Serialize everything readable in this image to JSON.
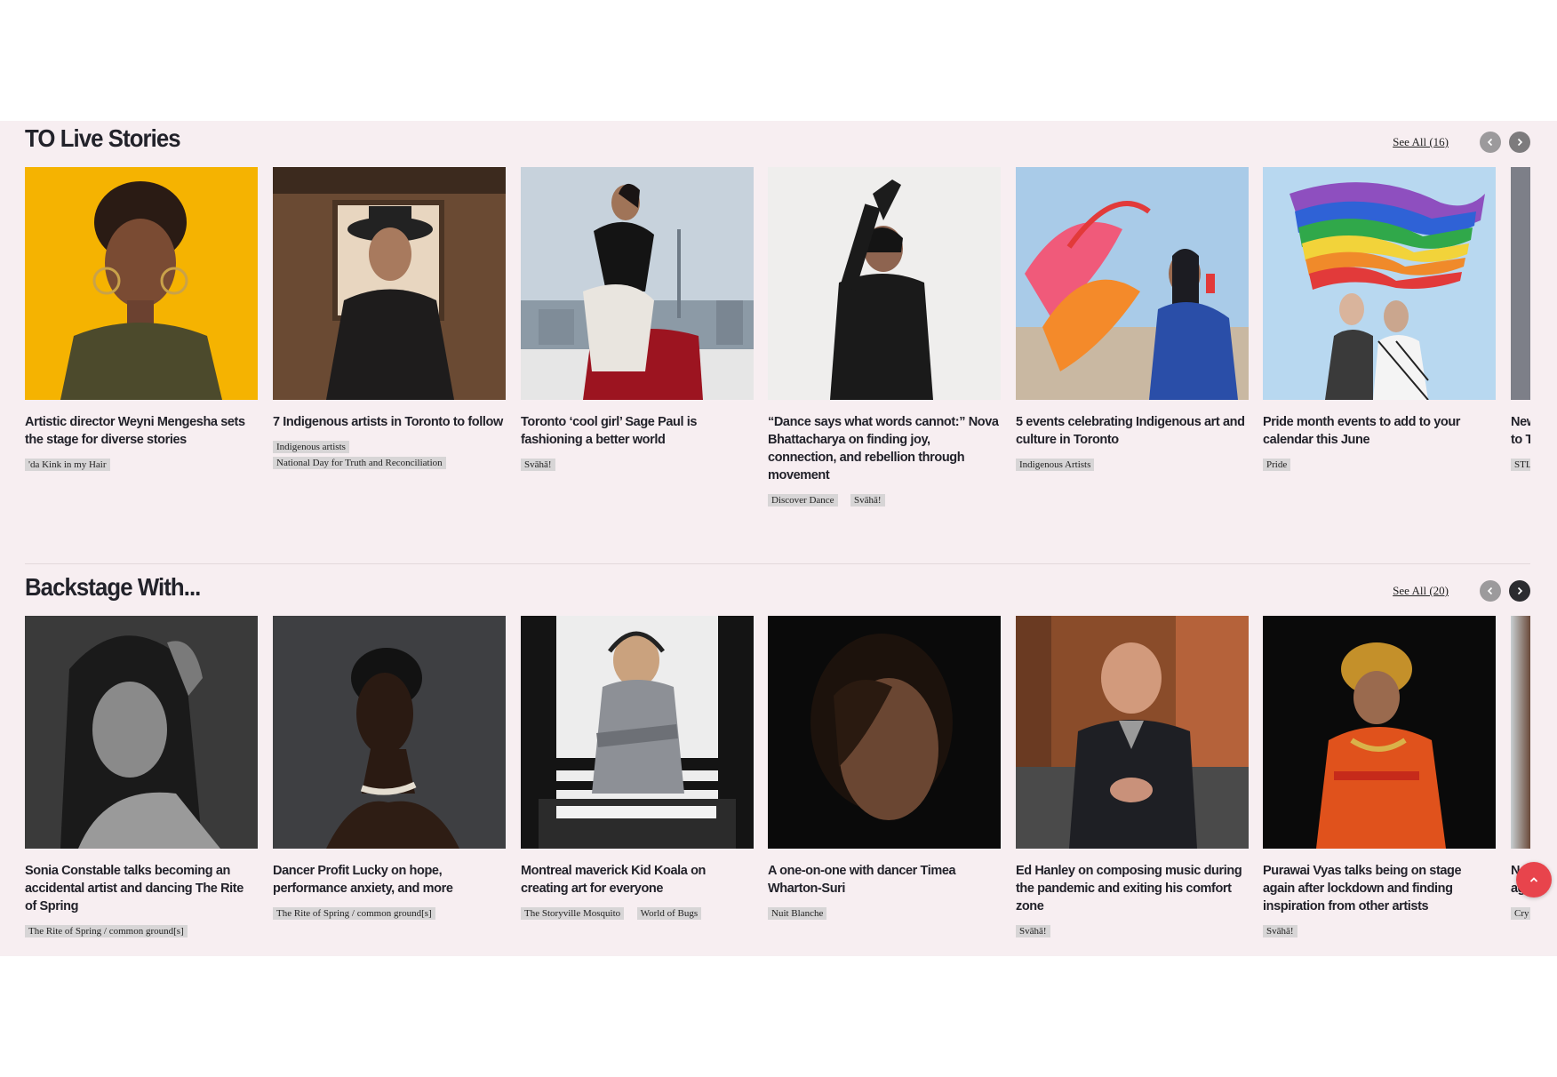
{
  "stories": {
    "title": "TO Live Stories",
    "see_all": "See All (16)",
    "cards": [
      {
        "title": "Artistic director Weyni Mengesha sets the stage for diverse stories",
        "tags": [
          "'da Kink in my Hair"
        ]
      },
      {
        "title": "7 Indigenous artists in Toronto to follow",
        "tags": [
          "Indigenous artists",
          "National Day for Truth and Reconciliation"
        ]
      },
      {
        "title": "Toronto ‘cool girl’ Sage Paul is fashioning a better world",
        "tags": [
          "Svāhā!"
        ]
      },
      {
        "title": "“Dance says what words cannot:” Nova Bhattacharya on finding joy, connection, and rebellion through movement",
        "tags": [
          "Discover Dance",
          "Svāhā!"
        ]
      },
      {
        "title": "5 events celebrating Indigenous art and culture in Toronto",
        "tags": [
          "Indigenous Artists"
        ]
      },
      {
        "title": "Pride month events to add to your calendar this June",
        "tags": [
          "Pride"
        ]
      }
    ],
    "partial": {
      "line1": "New",
      "line2": "to T",
      "tag": "STL"
    }
  },
  "backstage": {
    "title": "Backstage With...",
    "see_all": "See All (20)",
    "cards": [
      {
        "title": "Sonia Constable talks becoming an accidental artist and dancing The Rite of Spring",
        "tags": [
          "The Rite of Spring / common ground[s]"
        ]
      },
      {
        "title": "Dancer Profit Lucky on hope, performance anxiety, and more",
        "tags": [
          "The Rite of Spring / common ground[s]"
        ]
      },
      {
        "title": "Montreal maverick Kid Koala on creating art for everyone",
        "tags": [
          "The Storyville Mosquito",
          "World of Bugs"
        ]
      },
      {
        "title": "A one-on-one with dancer Timea Wharton-Suri",
        "tags": [
          "Nuit Blanche"
        ]
      },
      {
        "title": "Ed Hanley on composing music during the pandemic and exiting his comfort zone",
        "tags": [
          "Svāhā!"
        ]
      },
      {
        "title": "Purawai Vyas talks being on stage again after lockdown and finding inspiration from other artists",
        "tags": [
          "Svāhā!"
        ]
      }
    ],
    "partial": {
      "line1": "N",
      "line2": "ag",
      "tag": "Cry"
    }
  },
  "colors": {
    "band": "#f7eef1",
    "scroll_top": "#e8444c",
    "tag_bg": "#d7d5d6"
  },
  "icons": {
    "prev": "chevron-left-icon",
    "next": "chevron-right-icon",
    "scroll_top": "chevron-up-icon"
  }
}
